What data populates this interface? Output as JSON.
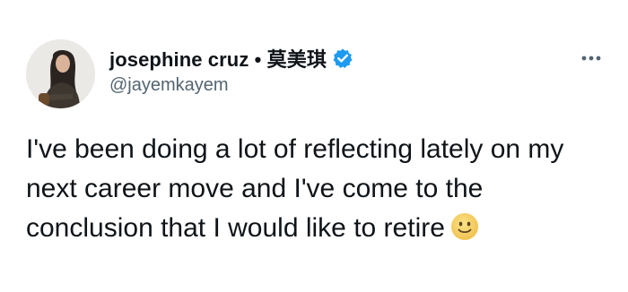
{
  "tweet": {
    "author": {
      "display_name": "josephine cruz • 莫美琪",
      "handle": "@jayemkayem",
      "verified": true,
      "avatar_icon": "profile-photo"
    },
    "text": "I've been doing a lot of reflecting lately on my next career move and I've come to the conclusion that I would like to retire",
    "emoji": "slightly-smiling-face-icon",
    "more_icon": "more-options-icon"
  },
  "colors": {
    "text_primary": "#0f1419",
    "text_secondary": "#536471",
    "verified_blue": "#1d9bf0",
    "emoji_yellow": "#f7d46a"
  }
}
